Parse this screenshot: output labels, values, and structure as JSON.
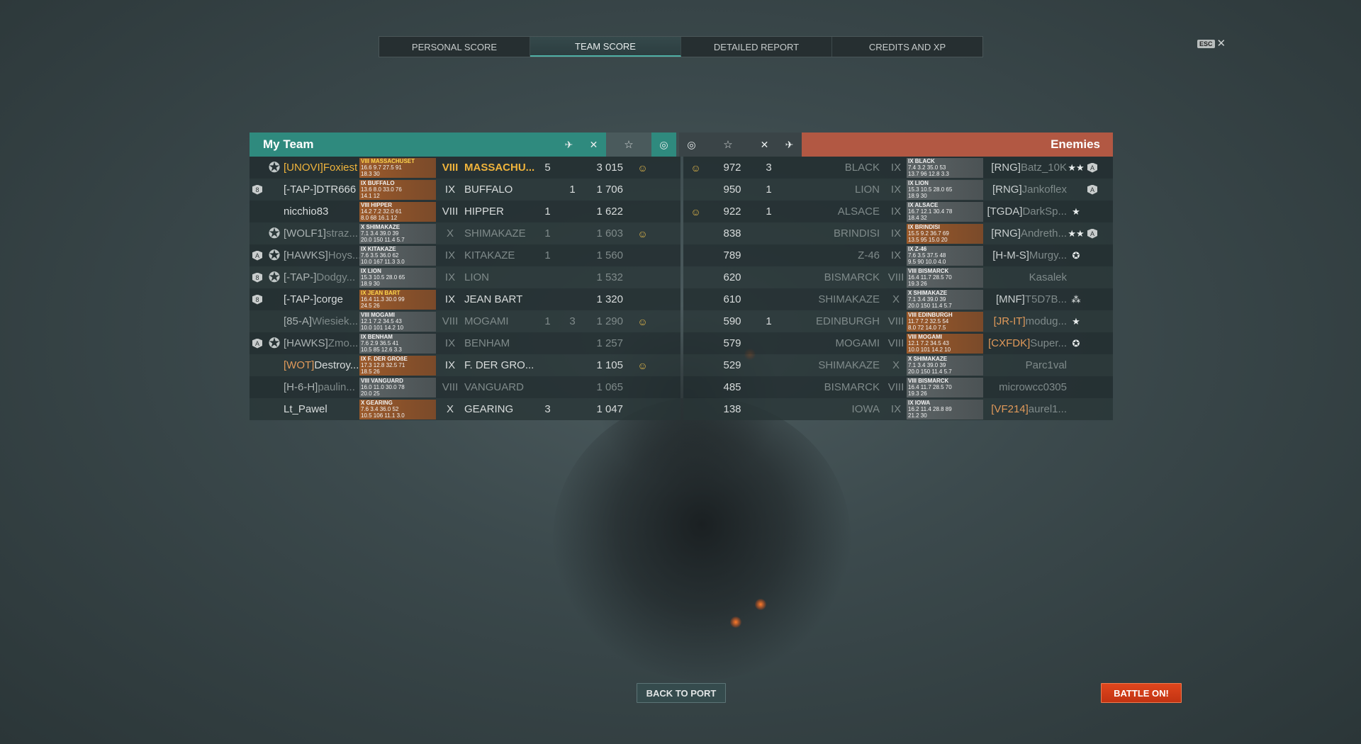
{
  "tabs": [
    {
      "label": "PERSONAL SCORE"
    },
    {
      "label": "TEAM SCORE"
    },
    {
      "label": "DETAILED REPORT"
    },
    {
      "label": "CREDITS AND XP"
    }
  ],
  "esc": {
    "key": "ESC",
    "close": "✕"
  },
  "header": {
    "my_team": "My Team",
    "enemies": "Enemies",
    "icons": {
      "planes": "✈",
      "kills": "✕",
      "xp": "☆",
      "caps": "◎"
    }
  },
  "my_team": [
    {
      "badge": "",
      "medal": "✪",
      "clan": "[UNOVI]",
      "nick": "Foxiest",
      "style": "gold",
      "card": {
        "title": "VIII MASSACHUSET",
        "l1": "16.6 9.7 27.5 91",
        "l2": "18.3 30",
        "color": "o",
        "yel": true
      },
      "tier": "VIII",
      "ship": "MASSACHU...",
      "planes": "5",
      "kills": "",
      "xp": "3 015",
      "cap": "☺"
    },
    {
      "badge": "8",
      "medal": "",
      "clan": "[-TAP-]",
      "nick": "DTR666",
      "style": "",
      "card": {
        "title": "IX BUFFALO",
        "l1": "13.6 8.0 33.0 76",
        "l2": "14.1 12",
        "color": "o",
        "yel": false
      },
      "tier": "IX",
      "ship": "BUFFALO",
      "planes": "",
      "kills": "1",
      "xp": "1 706",
      "cap": ""
    },
    {
      "badge": "",
      "medal": "",
      "clan": "",
      "nick": "nicchio83",
      "style": "",
      "card": {
        "title": "VIII HIPPER",
        "l1": "14.2 7.2 32.0 61",
        "l2": "8.0 68 16.1 12",
        "color": "o",
        "yel": false
      },
      "tier": "VIII",
      "ship": "HIPPER",
      "planes": "1",
      "kills": "",
      "xp": "1 622",
      "cap": ""
    },
    {
      "badge": "",
      "medal": "✪",
      "clan": "[WOLF1]",
      "nick": "straz...",
      "style": "orange dim",
      "card": {
        "title": "X SHIMAKAZE",
        "l1": "7.1 3.4 39.0 39",
        "l2": "20.0 150 11.4 5.7",
        "color": "g",
        "yel": false
      },
      "tier": "X",
      "ship": "SHIMAKAZE",
      "planes": "1",
      "kills": "",
      "xp": "1 603",
      "cap": "☺",
      "dimall": true
    },
    {
      "badge": "A",
      "medal": "✪",
      "clan": "[HAWKS]",
      "nick": "Hoys...",
      "style": "orange dim",
      "card": {
        "title": "IX KITAKAZE",
        "l1": "7.6 3.5 36.0 62",
        "l2": "10.0 167 11.3 3.0",
        "color": "g",
        "yel": false
      },
      "tier": "IX",
      "ship": "KITAKAZE",
      "planes": "1",
      "kills": "",
      "xp": "1 560",
      "cap": "",
      "dimall": true
    },
    {
      "badge": "8",
      "medal": "✪",
      "clan": "[-TAP-]",
      "nick": "Dodgy...",
      "style": "dim",
      "card": {
        "title": "IX LION",
        "l1": "15.3 10.5 28.0 65",
        "l2": "18.9 30",
        "color": "g",
        "yel": false
      },
      "tier": "IX",
      "ship": "LION",
      "planes": "",
      "kills": "",
      "xp": "1 532",
      "cap": "",
      "dimall": true
    },
    {
      "badge": "8",
      "medal": "",
      "clan": "[-TAP-]",
      "nick": "corge",
      "style": "",
      "card": {
        "title": "IX JEAN BART",
        "l1": "16.4 11.3 30.0 99",
        "l2": "24.5 26",
        "color": "o",
        "yel": true
      },
      "tier": "IX",
      "ship": "JEAN BART",
      "planes": "",
      "kills": "",
      "xp": "1 320",
      "cap": ""
    },
    {
      "badge": "",
      "medal": "",
      "clan": "[85-A]",
      "nick": "Wiesiek...",
      "style": "dim",
      "card": {
        "title": "VIII MOGAMI",
        "l1": "12.1 7.2 34.5 43",
        "l2": "10.0 101 14.2 10",
        "color": "g",
        "yel": false
      },
      "tier": "VIII",
      "ship": "MOGAMI",
      "planes": "1",
      "kills": "3",
      "xp": "1 290",
      "cap": "☺",
      "dimall": true
    },
    {
      "badge": "A",
      "medal": "✪",
      "clan": "[HAWKS]",
      "nick": "Zmo...",
      "style": "orange dim",
      "card": {
        "title": "IX BENHAM",
        "l1": "7.6 2.9 36.5 41",
        "l2": "10.5 85 12.6 3.3",
        "color": "g",
        "yel": false
      },
      "tier": "IX",
      "ship": "BENHAM",
      "planes": "",
      "kills": "",
      "xp": "1 257",
      "cap": "",
      "dimall": true
    },
    {
      "badge": "",
      "medal": "",
      "clan": "[WOT]",
      "nick": "Destroy...",
      "style": "orange",
      "card": {
        "title": "IX F. DER GROßE",
        "l1": "17.3 12.8 32.5 71",
        "l2": "18.5 26",
        "color": "o",
        "yel": false
      },
      "tier": "IX",
      "ship": "F. DER GRO...",
      "planes": "",
      "kills": "",
      "xp": "1 105",
      "cap": "☺"
    },
    {
      "badge": "",
      "medal": "",
      "clan": "[H-6-H]",
      "nick": "paulin...",
      "style": "dim",
      "card": {
        "title": "VIII VANGUARD",
        "l1": "16.0 11.0 30.0 78",
        "l2": "20.0 25",
        "color": "g",
        "yel": false
      },
      "tier": "VIII",
      "ship": "VANGUARD",
      "planes": "",
      "kills": "",
      "xp": "1 065",
      "cap": "",
      "dimall": true
    },
    {
      "badge": "",
      "medal": "",
      "clan": "",
      "nick": "Lt_Pawel",
      "style": "",
      "card": {
        "title": "X GEARING",
        "l1": "7.6 3.4 36.0 52",
        "l2": "10.5 106 11.1 3.0",
        "color": "o",
        "yel": false
      },
      "tier": "X",
      "ship": "GEARING",
      "planes": "3",
      "kills": "",
      "xp": "1 047",
      "cap": ""
    }
  ],
  "enemies": [
    {
      "cap": "☺",
      "xp": "972",
      "kills": "3",
      "ship": "BLACK",
      "tier": "IX",
      "card": {
        "title": "IX BLACK",
        "l1": "7.4 3.2 35.0 53",
        "l2": "13.7 96 12.8 3.3"
      },
      "clan": "[RNG]",
      "nick": "Batz_10K",
      "medal": "★★",
      "badge": "A"
    },
    {
      "cap": "",
      "xp": "950",
      "kills": "1",
      "ship": "LION",
      "tier": "IX",
      "card": {
        "title": "IX LION",
        "l1": "15.3 10.5 28.0 65",
        "l2": "18.9 30"
      },
      "clan": "[RNG]",
      "nick": "Jankoflex",
      "medal": "",
      "badge": "A"
    },
    {
      "cap": "☺",
      "xp": "922",
      "kills": "1",
      "ship": "ALSACE",
      "tier": "IX",
      "card": {
        "title": "IX ALSACE",
        "l1": "16.7 12.1 30.4 78",
        "l2": "18.4 32"
      },
      "clan": "[TGDA]",
      "nick": "DarkSp...",
      "medal": "★",
      "badge": ""
    },
    {
      "cap": "",
      "xp": "838",
      "kills": "",
      "ship": "BRINDISI",
      "tier": "IX",
      "card": {
        "title": "IX BRINDISI",
        "l1": "15.5 9.2 36.7 69",
        "l2": "13.5 95 15.0 20",
        "orange": true
      },
      "clan": "[RNG]",
      "nick": "Andreth...",
      "medal": "★★",
      "badge": "A"
    },
    {
      "cap": "",
      "xp": "789",
      "kills": "",
      "ship": "Z-46",
      "tier": "IX",
      "card": {
        "title": "IX Z-46",
        "l1": "7.6 3.5 37.5 48",
        "l2": "9.5 90 10.0 4.0"
      },
      "clan": "[H-M-S]",
      "nick": "Murgy...",
      "medal": "✪",
      "badge": ""
    },
    {
      "cap": "",
      "xp": "620",
      "kills": "",
      "ship": "BISMARCK",
      "tier": "VIII",
      "card": {
        "title": "VIII BISMARCK",
        "l1": "16.4 11.7 28.5 70",
        "l2": "19.3 26"
      },
      "clan": "",
      "nick": "Kasalek",
      "medal": "",
      "badge": ""
    },
    {
      "cap": "",
      "xp": "610",
      "kills": "",
      "ship": "SHIMAKAZE",
      "tier": "X",
      "card": {
        "title": "X SHIMAKAZE",
        "l1": "7.1 3.4 39.0 39",
        "l2": "20.0 150 11.4 5.7"
      },
      "clan": "[MNF]",
      "nick": "T5D7B...",
      "medal": "⁂",
      "badge": ""
    },
    {
      "cap": "",
      "xp": "590",
      "kills": "1",
      "ship": "EDINBURGH",
      "tier": "VIII",
      "card": {
        "title": "VIII EDINBURGH",
        "l1": "11.7 7.2 32.5 54",
        "l2": "8.0 72 14.0 7.5",
        "orange": true
      },
      "clan": "[JR-IT]",
      "nick": "modug...",
      "medal": "★",
      "badge": ""
    },
    {
      "cap": "",
      "xp": "579",
      "kills": "",
      "ship": "MOGAMI",
      "tier": "VIII",
      "card": {
        "title": "VIII MOGAMI",
        "l1": "12.1 7.2 34.5 43",
        "l2": "10.0 101 14.2 10",
        "orange": true
      },
      "clan": "[CXFDK]",
      "nick": "Super...",
      "medal": "✪",
      "badge": ""
    },
    {
      "cap": "",
      "xp": "529",
      "kills": "",
      "ship": "SHIMAKAZE",
      "tier": "X",
      "card": {
        "title": "X SHIMAKAZE",
        "l1": "7.1 3.4 39.0 39",
        "l2": "20.0 150 11.4 5.7"
      },
      "clan": "",
      "nick": "Parc1val",
      "medal": "",
      "badge": ""
    },
    {
      "cap": "",
      "xp": "485",
      "kills": "",
      "ship": "BISMARCK",
      "tier": "VIII",
      "card": {
        "title": "VIII BISMARCK",
        "l1": "16.4 11.7 28.5 70",
        "l2": "19.3 26"
      },
      "clan": "",
      "nick": "microwcc0305",
      "medal": "",
      "badge": ""
    },
    {
      "cap": "",
      "xp": "138",
      "kills": "",
      "ship": "IOWA",
      "tier": "IX",
      "card": {
        "title": "IX IOWA",
        "l1": "16.2 11.4 28.8 89",
        "l2": "21.2 30"
      },
      "clan": "[VF214]",
      "nick": "aurel1...",
      "medal": "",
      "badge": ""
    }
  ],
  "buttons": {
    "back": "BACK TO PORT",
    "battle": "BATTLE ON!"
  }
}
